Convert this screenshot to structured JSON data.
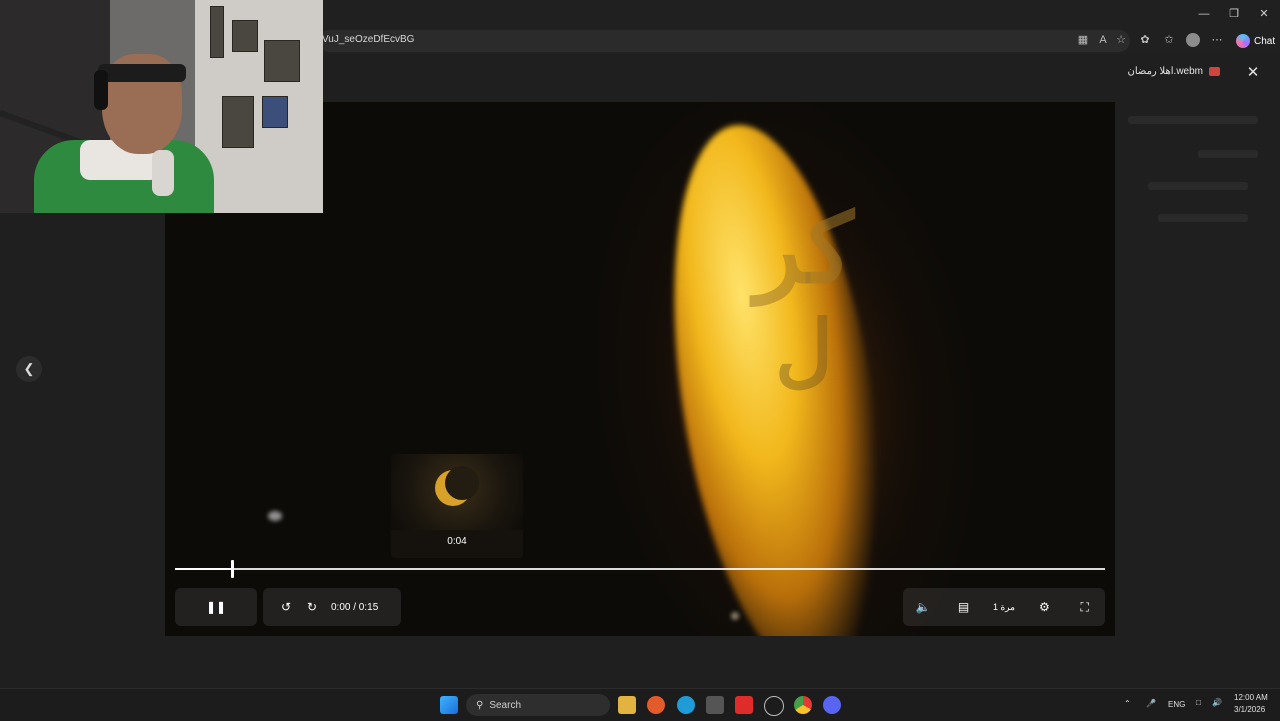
{
  "browser": {
    "url": "VuJ_seOzeDfEcvBG",
    "chat_label": "Chat",
    "window_controls": [
      "minimize-icon",
      "restore-icon",
      "close-icon"
    ]
  },
  "viewer": {
    "file_name": "اهلا رمضان.webm",
    "close_icon": "close-icon",
    "prev_icon": "chevron-left-icon"
  },
  "player": {
    "preview_time": "0:04",
    "time_display": "0:00 / 0:15",
    "speed_label": "1 مرة",
    "progress_fraction": 0.061,
    "buttons": [
      "pause-icon",
      "rewind-10-icon",
      "forward-10-icon",
      "volume-icon",
      "captions-icon",
      "speed-icon",
      "settings-icon",
      "fullscreen-icon"
    ]
  },
  "taskbar": {
    "search_placeholder": "Search",
    "language": "ENG",
    "time": "12:00 AM",
    "date": "3/1/2026",
    "apps": [
      "windows-start-icon",
      "file-explorer-icon",
      "firefox-icon",
      "edge-icon",
      "store-icon",
      "youtube-icon",
      "app-icon",
      "chrome-icon",
      "discord-icon"
    ]
  },
  "colors": {
    "accent_flame": "#f2b81c",
    "file_icon": "#d2453f",
    "webcam_hoodie": "#2e8a3e"
  }
}
